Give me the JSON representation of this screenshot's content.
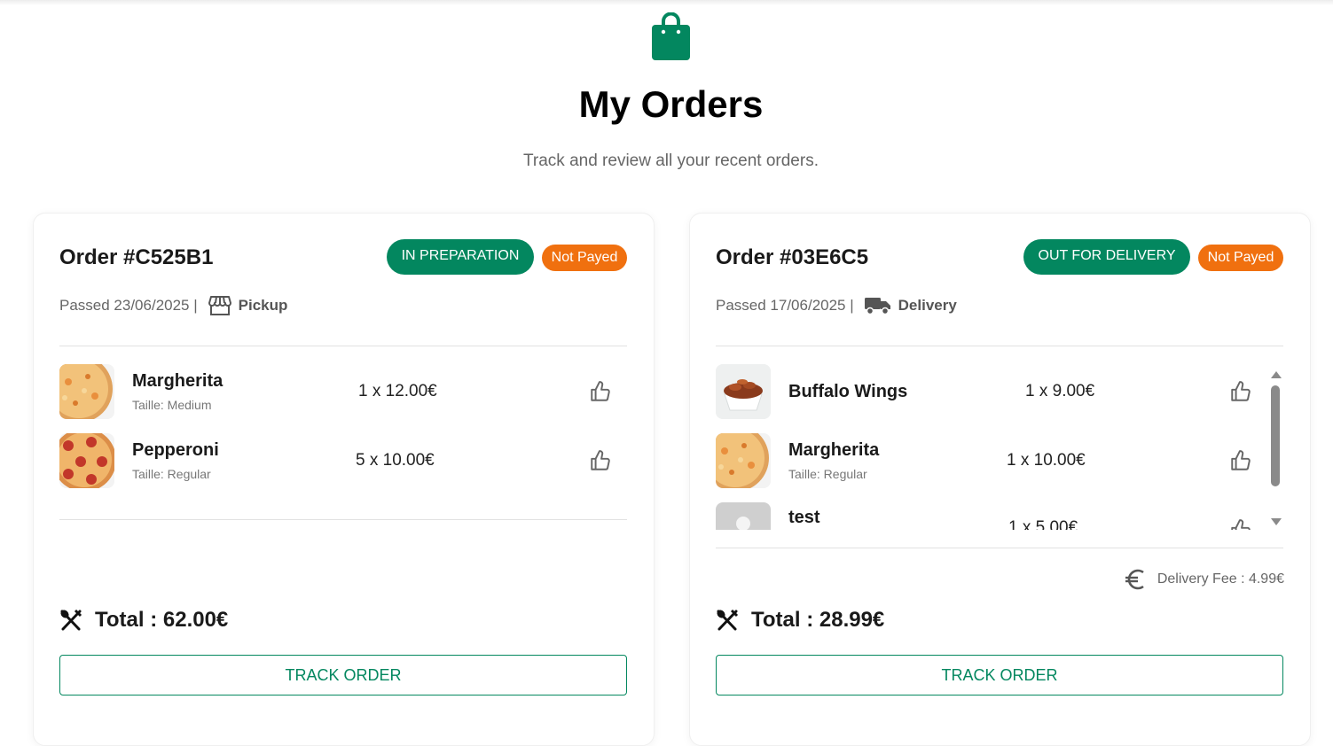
{
  "header": {
    "title": "My Orders",
    "subtitle": "Track and review all your recent orders.",
    "icon": "shopping-bag-icon",
    "accent_color": "#03875f"
  },
  "orders": [
    {
      "id_label": "Order #C525B1",
      "status": "IN PREPARATION",
      "status_color": "#03875f",
      "payment": "Not Payed",
      "payment_color": "#f0700f",
      "passed": "Passed 23/06/2025 |",
      "mode": "Pickup",
      "mode_icon": "storefront-icon",
      "items": [
        {
          "name": "Margherita",
          "size": "Taille: Medium",
          "qty": "1 x 12.00€",
          "image": "pizza-margherita"
        },
        {
          "name": "Pepperoni",
          "size": "Taille: Regular",
          "qty": "5 x 10.00€",
          "image": "pizza-pepperoni"
        }
      ],
      "total": "Total : 62.00€",
      "track_label": "TRACK ORDER"
    },
    {
      "id_label": "Order #03E6C5",
      "status": "OUT FOR DELIVERY",
      "status_color": "#03875f",
      "payment": "Not Payed",
      "payment_color": "#f0700f",
      "passed": "Passed 17/06/2025 |",
      "mode": "Delivery",
      "mode_icon": "truck-icon",
      "items": [
        {
          "name": "Buffalo Wings",
          "size": "",
          "qty": "1 x 9.00€",
          "image": "buffalo-wings"
        },
        {
          "name": "Margherita",
          "size": "Taille: Regular",
          "qty": "1 x 10.00€",
          "image": "pizza-margherita"
        },
        {
          "name": "test",
          "size": "",
          "qty": "1 x 5.00€",
          "image": "placeholder"
        }
      ],
      "delivery_fee": "Delivery Fee : 4.99€",
      "total": "Total : 28.99€",
      "track_label": "TRACK ORDER"
    }
  ]
}
